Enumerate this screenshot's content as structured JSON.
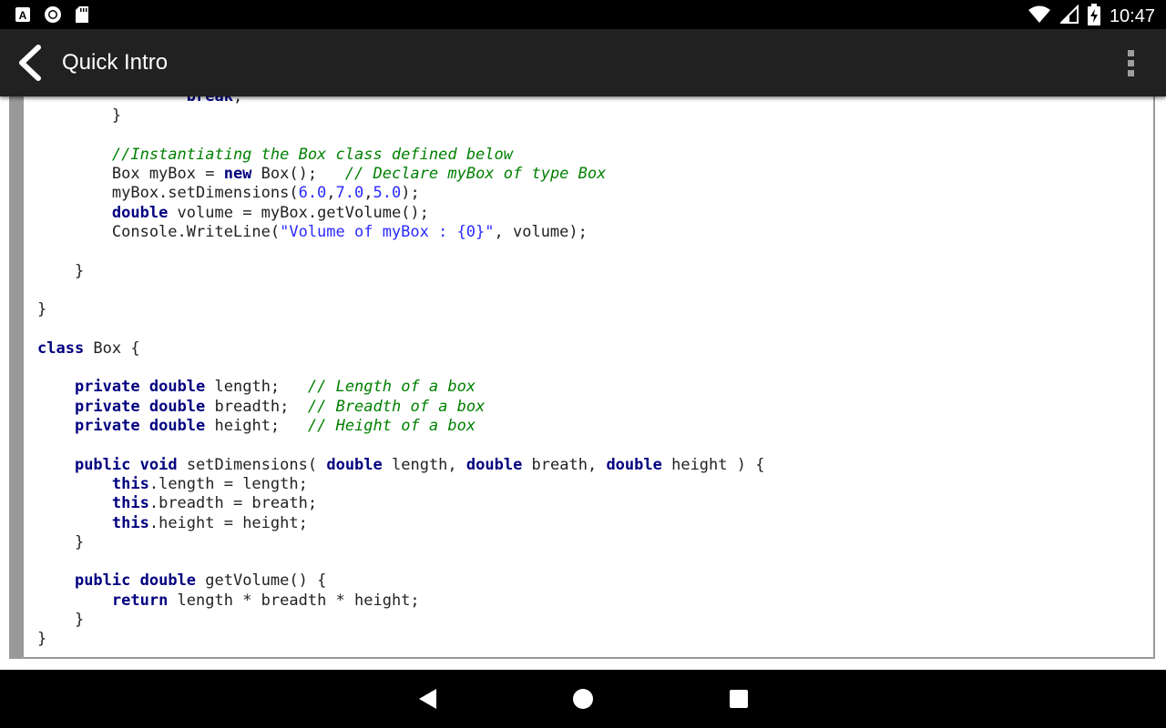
{
  "status_bar": {
    "time": "10:47",
    "left_icons": [
      "text-a-icon",
      "circle-icon",
      "sd-card-icon"
    ],
    "right_icons": [
      "wifi-icon",
      "signal-icon",
      "battery-charging-icon"
    ]
  },
  "app_bar": {
    "title": "Quick Intro",
    "back_icon": "chevron-left-icon",
    "menu_icon": "more-vert-icon"
  },
  "code_lines": [
    "                break;",
    "        }",
    "",
    "        //Instantiating the Box class defined below",
    "        Box myBox = new Box();   // Declare myBox of type Box",
    "        myBox.setDimensions(6.0,7.0,5.0);",
    "        double volume = myBox.getVolume();",
    "        Console.WriteLine(\"Volume of myBox : {0}\", volume);",
    "",
    "    }",
    "",
    "}",
    "",
    "class Box {",
    "",
    "    private double length;   // Length of a box",
    "    private double breadth;  // Breadth of a box",
    "    private double height;   // Height of a box",
    "",
    "    public void setDimensions( double length, double breath, double height ) {",
    "        this.length = length;",
    "        this.breadth = breath;",
    "        this.height = height;",
    "    }",
    "",
    "    public double getVolume() {",
    "        return length * breadth * height;",
    "    }",
    "}"
  ],
  "nav_bar": {
    "back_icon": "nav-back-icon",
    "home_icon": "nav-home-icon",
    "recents_icon": "nav-recents-icon"
  }
}
